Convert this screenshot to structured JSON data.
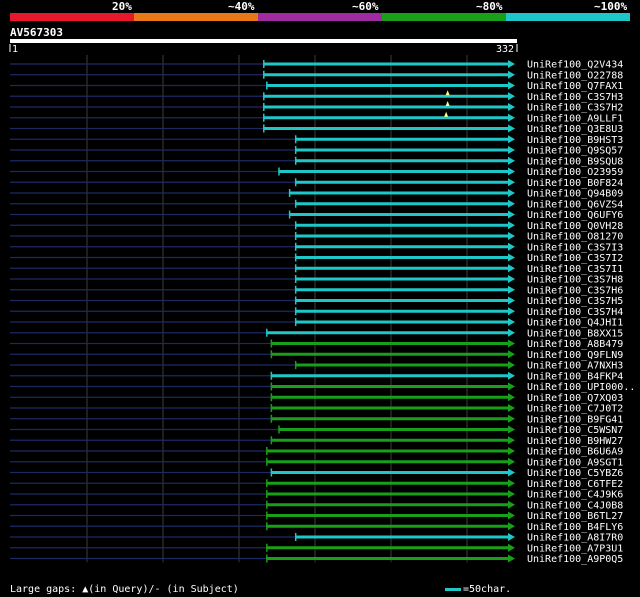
{
  "legend": {
    "labels": [
      "20%",
      "~40%",
      "~60%",
      "~80%",
      "~100%"
    ],
    "colors": [
      "#e8182c",
      "#e87818",
      "#a02aa0",
      "#18a018",
      "#1ec8c8"
    ]
  },
  "query": {
    "id": "AV567303",
    "start": "1",
    "end": "332"
  },
  "footer": {
    "gaps_text": "Large gaps: ▲(in Query)/- (in Subject)",
    "scale_text": "=50char."
  },
  "chart_data": {
    "type": "alignment",
    "query_length": 332,
    "x_range": [
      1,
      332
    ],
    "hits": [
      {
        "id": "UniRef100_Q2V434",
        "start": 168,
        "end": 332,
        "identity": "~100%",
        "query_gaps": []
      },
      {
        "id": "UniRef100_O22788",
        "start": 168,
        "end": 332,
        "identity": "~100%",
        "query_gaps": []
      },
      {
        "id": "UniRef100_Q7FAX1",
        "start": 170,
        "end": 332,
        "identity": "~100%",
        "query_gaps": []
      },
      {
        "id": "UniRef100_C3S7H3",
        "start": 168,
        "end": 332,
        "identity": "~100%",
        "query_gaps": [
          289
        ]
      },
      {
        "id": "UniRef100_C3S7H2",
        "start": 168,
        "end": 332,
        "identity": "~100%",
        "query_gaps": [
          289
        ]
      },
      {
        "id": "UniRef100_A9LLF1",
        "start": 168,
        "end": 332,
        "identity": "~100%",
        "query_gaps": [
          288
        ]
      },
      {
        "id": "UniRef100_Q3E8U3",
        "start": 168,
        "end": 332,
        "identity": "~100%",
        "query_gaps": []
      },
      {
        "id": "UniRef100_B9HST3",
        "start": 189,
        "end": 332,
        "identity": "~100%",
        "query_gaps": []
      },
      {
        "id": "UniRef100_Q9SQ57",
        "start": 189,
        "end": 332,
        "identity": "~100%",
        "query_gaps": []
      },
      {
        "id": "UniRef100_B9SQU8",
        "start": 189,
        "end": 332,
        "identity": "~100%",
        "query_gaps": []
      },
      {
        "id": "UniRef100_O23959",
        "start": 178,
        "end": 332,
        "identity": "~100%",
        "query_gaps": []
      },
      {
        "id": "UniRef100_B0F824",
        "start": 189,
        "end": 332,
        "identity": "~100%",
        "query_gaps": []
      },
      {
        "id": "UniRef100_Q94B09",
        "start": 185,
        "end": 332,
        "identity": "~100%",
        "query_gaps": []
      },
      {
        "id": "UniRef100_Q6VZS4",
        "start": 189,
        "end": 332,
        "identity": "~100%",
        "query_gaps": []
      },
      {
        "id": "UniRef100_Q6UFY6",
        "start": 185,
        "end": 332,
        "identity": "~100%",
        "query_gaps": []
      },
      {
        "id": "UniRef100_Q0VH28",
        "start": 189,
        "end": 332,
        "identity": "~100%",
        "query_gaps": []
      },
      {
        "id": "UniRef100_O81270",
        "start": 189,
        "end": 332,
        "identity": "~100%",
        "query_gaps": []
      },
      {
        "id": "UniRef100_C3S7I3",
        "start": 189,
        "end": 332,
        "identity": "~100%",
        "query_gaps": []
      },
      {
        "id": "UniRef100_C3S7I2",
        "start": 189,
        "end": 332,
        "identity": "~100%",
        "query_gaps": []
      },
      {
        "id": "UniRef100_C3S7I1",
        "start": 189,
        "end": 332,
        "identity": "~100%",
        "query_gaps": []
      },
      {
        "id": "UniRef100_C3S7H8",
        "start": 189,
        "end": 332,
        "identity": "~100%",
        "query_gaps": []
      },
      {
        "id": "UniRef100_C3S7H6",
        "start": 189,
        "end": 332,
        "identity": "~100%",
        "query_gaps": []
      },
      {
        "id": "UniRef100_C3S7H5",
        "start": 189,
        "end": 332,
        "identity": "~100%",
        "query_gaps": []
      },
      {
        "id": "UniRef100_C3S7H4",
        "start": 189,
        "end": 332,
        "identity": "~100%",
        "query_gaps": []
      },
      {
        "id": "UniRef100_Q4JHI1",
        "start": 189,
        "end": 332,
        "identity": "~100%",
        "query_gaps": []
      },
      {
        "id": "UniRef100_B8XX15",
        "start": 170,
        "end": 332,
        "identity": "~100%",
        "query_gaps": []
      },
      {
        "id": "UniRef100_A8B479",
        "start": 173,
        "end": 332,
        "identity": "~80%",
        "query_gaps": []
      },
      {
        "id": "UniRef100_Q9FLN9",
        "start": 173,
        "end": 332,
        "identity": "~80%",
        "query_gaps": []
      },
      {
        "id": "UniRef100_A7NXH3",
        "start": 189,
        "end": 332,
        "identity": "~80%",
        "query_gaps": []
      },
      {
        "id": "UniRef100_B4FKP4",
        "start": 173,
        "end": 332,
        "identity": "~100%",
        "query_gaps": []
      },
      {
        "id": "UniRef100_UPI000..",
        "start": 173,
        "end": 332,
        "identity": "~80%",
        "query_gaps": []
      },
      {
        "id": "UniRef100_Q7XQ03",
        "start": 173,
        "end": 332,
        "identity": "~80%",
        "query_gaps": []
      },
      {
        "id": "UniRef100_C7J0T2",
        "start": 173,
        "end": 332,
        "identity": "~80%",
        "query_gaps": []
      },
      {
        "id": "UniRef100_B9FG41",
        "start": 173,
        "end": 332,
        "identity": "~80%",
        "query_gaps": []
      },
      {
        "id": "UniRef100_C5WSN7",
        "start": 178,
        "end": 332,
        "identity": "~80%",
        "query_gaps": []
      },
      {
        "id": "UniRef100_B9HW27",
        "start": 173,
        "end": 332,
        "identity": "~80%",
        "query_gaps": []
      },
      {
        "id": "UniRef100_B6U6A9",
        "start": 170,
        "end": 332,
        "identity": "~80%",
        "query_gaps": []
      },
      {
        "id": "UniRef100_A9SGT1",
        "start": 170,
        "end": 332,
        "identity": "~80%",
        "query_gaps": []
      },
      {
        "id": "UniRef100_C5YBZ6",
        "start": 173,
        "end": 332,
        "identity": "~100%",
        "query_gaps": []
      },
      {
        "id": "UniRef100_C6TFE2",
        "start": 170,
        "end": 332,
        "identity": "~80%",
        "query_gaps": []
      },
      {
        "id": "UniRef100_C4J9K6",
        "start": 170,
        "end": 332,
        "identity": "~80%",
        "query_gaps": []
      },
      {
        "id": "UniRef100_C4J0B8",
        "start": 170,
        "end": 332,
        "identity": "~80%",
        "query_gaps": []
      },
      {
        "id": "UniRef100_B6TL27",
        "start": 170,
        "end": 332,
        "identity": "~80%",
        "query_gaps": []
      },
      {
        "id": "UniRef100_B4FLY6",
        "start": 170,
        "end": 332,
        "identity": "~80%",
        "query_gaps": []
      },
      {
        "id": "UniRef100_A8I7R0",
        "start": 189,
        "end": 332,
        "identity": "~100%",
        "query_gaps": []
      },
      {
        "id": "UniRef100_A7P3U1",
        "start": 170,
        "end": 332,
        "identity": "~80%",
        "query_gaps": []
      },
      {
        "id": "UniRef100_A9P0Q5",
        "start": 170,
        "end": 332,
        "identity": "~80%",
        "query_gaps": []
      }
    ]
  }
}
